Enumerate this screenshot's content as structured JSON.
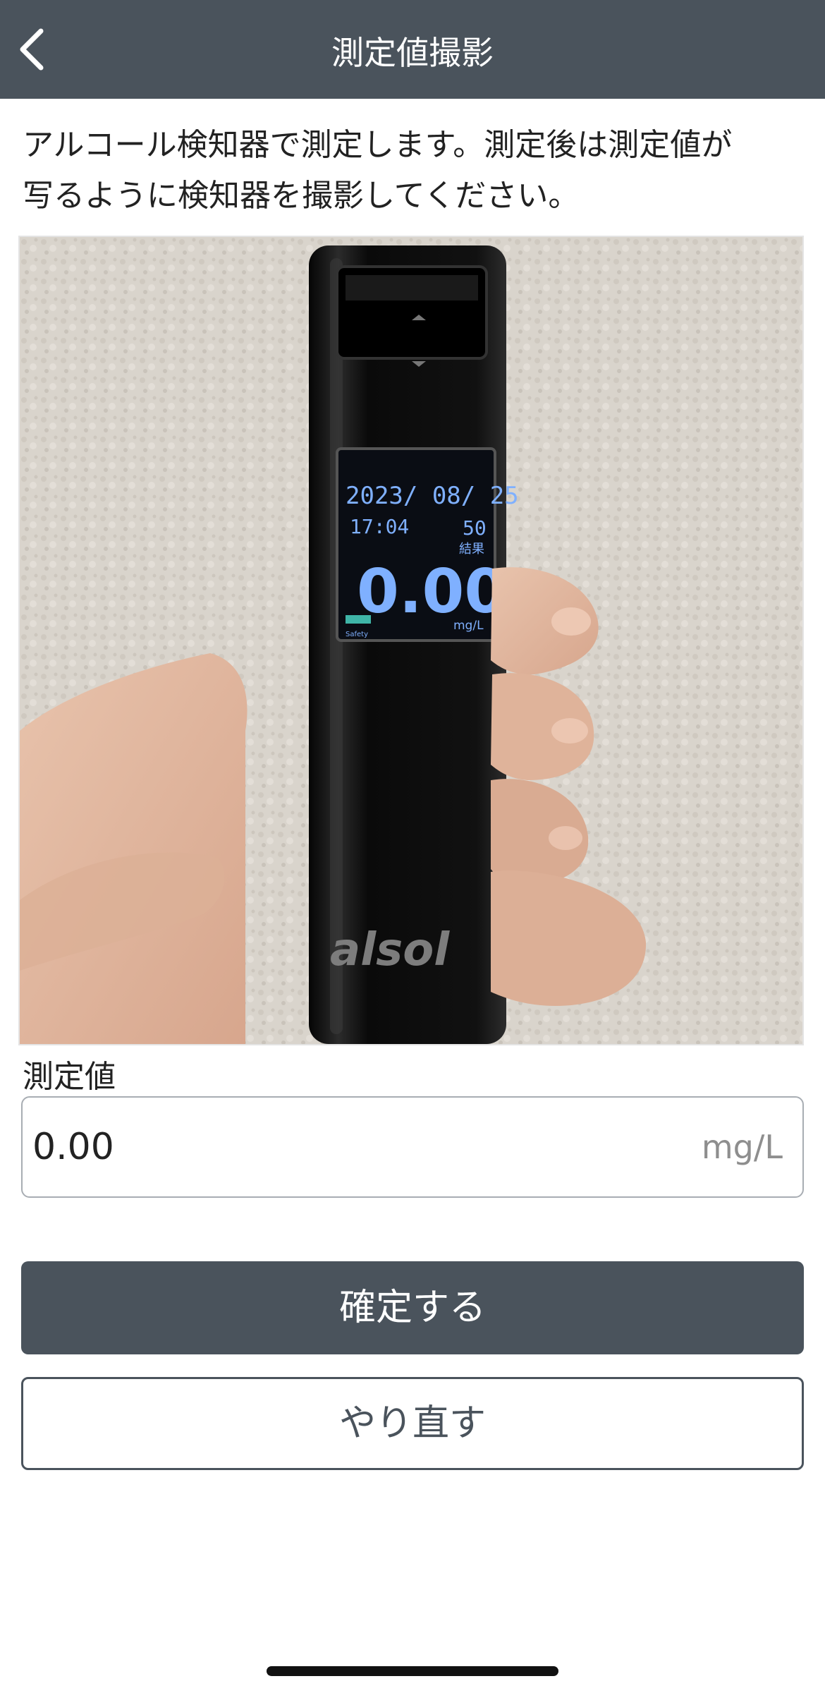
{
  "nav": {
    "title": "測定値撮影",
    "back_icon": "chevron-left-icon"
  },
  "instructions": {
    "line1": "アルコール検知器で測定します。測定後は測定値が",
    "line2": "写るように検知器を撮影してください。"
  },
  "photo": {
    "device_screen": {
      "date": "2023/ 08/ 25",
      "time": "17:04",
      "count": "50",
      "result_label": "結果",
      "reading": "0.00",
      "unit": "mg/L",
      "status": "Safety"
    },
    "brand": "alsol"
  },
  "measurement": {
    "label": "測定値",
    "value": "0.00",
    "unit": "mg/L"
  },
  "buttons": {
    "confirm": "確定する",
    "retake": "やり直す"
  },
  "colors": {
    "nav_bg": "#4a535c",
    "primary_button": "#4a535c",
    "lcd_text": "#7fb0ff"
  }
}
